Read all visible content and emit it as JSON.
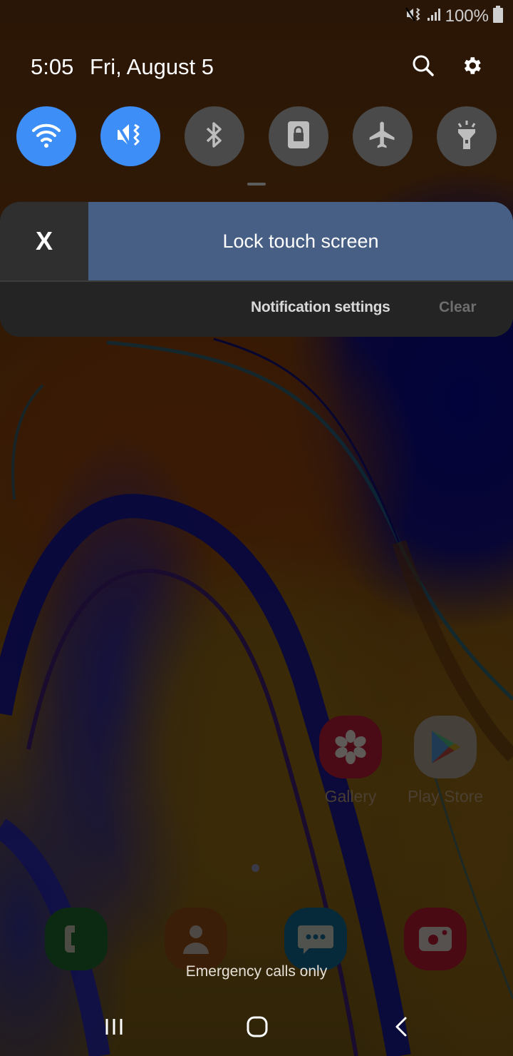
{
  "status_bar": {
    "icons": [
      "vibrate-mute-icon",
      "signal-icon",
      "battery-icon"
    ],
    "battery_percent": "100%"
  },
  "header": {
    "time": "5:05",
    "date": "Fri, August 5",
    "search_icon": "search-icon",
    "settings_icon": "gear-icon"
  },
  "quick_toggles": [
    {
      "name": "Wi-Fi",
      "icon": "wifi-icon",
      "state": "on"
    },
    {
      "name": "Vibrate",
      "icon": "vibrate-icon",
      "state": "on"
    },
    {
      "name": "Bluetooth",
      "icon": "bluetooth-icon",
      "state": "off"
    },
    {
      "name": "Screen lock rotation",
      "icon": "portrait-lock-icon",
      "state": "off"
    },
    {
      "name": "Airplane mode",
      "icon": "airplane-icon",
      "state": "off"
    },
    {
      "name": "Flashlight",
      "icon": "flashlight-icon",
      "state": "off"
    }
  ],
  "notification": {
    "close_label": "X",
    "title": "Lock touch screen",
    "settings_label": "Notification settings",
    "clear_label": "Clear"
  },
  "home": {
    "apps": [
      {
        "label": "Gallery",
        "icon": "gallery-icon"
      },
      {
        "label": "Play Store",
        "icon": "play-store-icon"
      }
    ],
    "dock": [
      {
        "name": "Phone",
        "icon": "phone-icon"
      },
      {
        "name": "Contacts",
        "icon": "contacts-icon"
      },
      {
        "name": "Messages",
        "icon": "messages-icon"
      },
      {
        "name": "Camera",
        "icon": "camera-icon"
      }
    ],
    "emergency_text": "Emergency calls only"
  },
  "nav_bar": {
    "recents": "recents-icon",
    "home": "home-icon",
    "back": "back-icon"
  },
  "colors": {
    "toggle_on": "#3d8ef6",
    "toggle_off": "#4a4a4a",
    "notification_accent": "#475f84",
    "panel": "#242424"
  }
}
